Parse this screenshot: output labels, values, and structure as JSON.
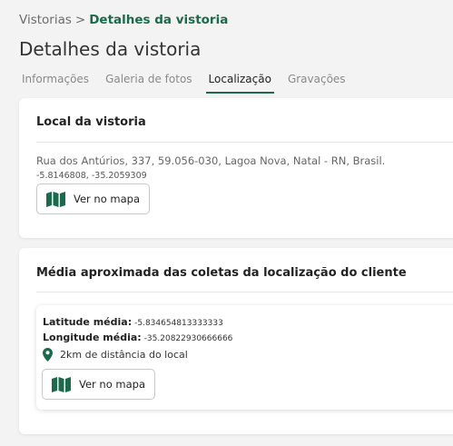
{
  "breadcrumb": {
    "parent": "Vistorias",
    "separator": ">",
    "current": "Detalhes da vistoria"
  },
  "page_title": "Detalhes da vistoria",
  "tabs": [
    {
      "label": "Informações"
    },
    {
      "label": "Galeria de fotos"
    },
    {
      "label": "Localização",
      "active": true
    },
    {
      "label": "Gravações"
    }
  ],
  "local_card": {
    "title": "Local da vistoria",
    "address": "Rua dos Antúrios, 337, 59.056-030, Lagoa Nova, Natal - RN, Brasil.",
    "coordinates": "-5.8146808, -35.2059309",
    "map_button_label": "Ver no mapa"
  },
  "average_card": {
    "title": "Média aproximada das coletas da localização do cliente",
    "latitude_label": "Latitude média:",
    "latitude_value": "-5.834654813333333",
    "longitude_label": "Longitude média:",
    "longitude_value": "-35.20822930666666",
    "distance_text": "2km de distância do local",
    "map_button_label": "Ver no mapa"
  },
  "colors": {
    "accent": "#1b6a4c",
    "background": "#f3f3f3"
  },
  "icons": [
    "map-icon",
    "location-pin-icon"
  ]
}
